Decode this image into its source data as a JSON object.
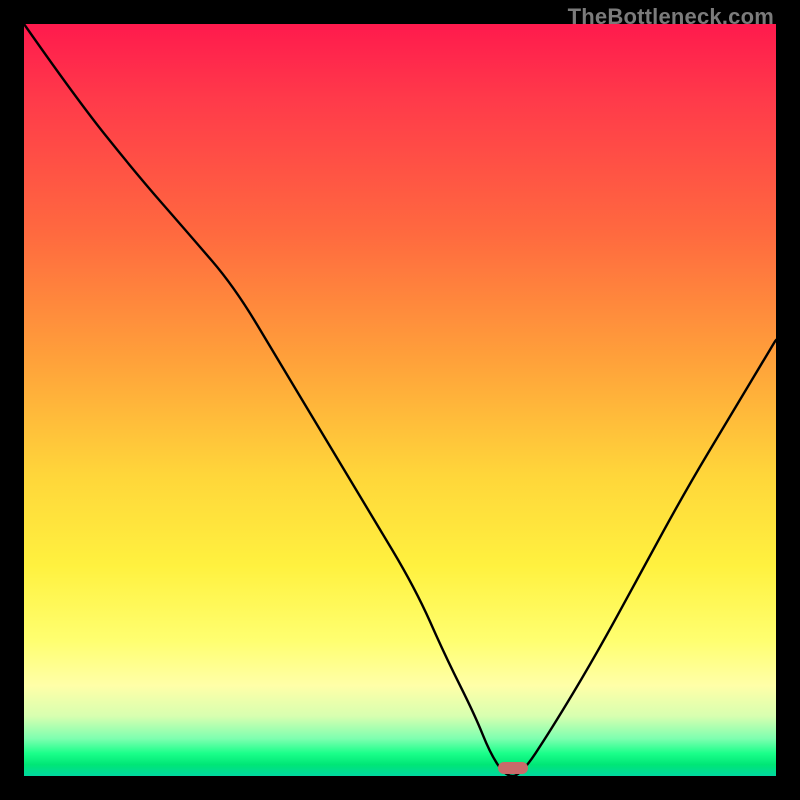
{
  "watermark": "TheBottleneck.com",
  "colors": {
    "background": "#000000",
    "curve": "#000000",
    "marker": "#c96a6a",
    "gradient_top": "#ff1a4d",
    "gradient_bottom": "#00d8a0"
  },
  "chart_data": {
    "type": "line",
    "title": "",
    "xlabel": "",
    "ylabel": "",
    "xlim": [
      0,
      100
    ],
    "ylim": [
      0,
      100
    ],
    "grid": false,
    "legend": false,
    "series": [
      {
        "name": "bottleneck-curve",
        "x": [
          0,
          7,
          15,
          22,
          28,
          34,
          40,
          46,
          52,
          56,
          60,
          62,
          64,
          66,
          70,
          76,
          82,
          88,
          94,
          100
        ],
        "values": [
          100,
          90,
          80,
          72,
          65,
          55,
          45,
          35,
          25,
          16,
          8,
          3,
          0,
          0,
          6,
          16,
          27,
          38,
          48,
          58
        ]
      }
    ],
    "annotations": [
      {
        "type": "marker",
        "x": 65,
        "y": 1,
        "shape": "pill",
        "color": "#c96a6a"
      }
    ],
    "background_gradient": {
      "direction": "vertical",
      "stops": [
        {
          "pos": 0,
          "color": "#ff1a4d"
        },
        {
          "pos": 28,
          "color": "#ff6a3f"
        },
        {
          "pos": 60,
          "color": "#ffd63a"
        },
        {
          "pos": 88,
          "color": "#ffffa8"
        },
        {
          "pos": 97,
          "color": "#1aff8a"
        },
        {
          "pos": 100,
          "color": "#00d8a0"
        }
      ]
    }
  }
}
